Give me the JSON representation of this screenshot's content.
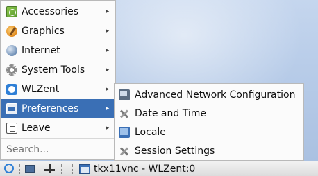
{
  "main_menu": {
    "items": [
      {
        "label": "Accessories",
        "icon": "accessories-icon",
        "has_submenu": true
      },
      {
        "label": "Graphics",
        "icon": "graphics-icon",
        "has_submenu": true
      },
      {
        "label": "Internet",
        "icon": "internet-icon",
        "has_submenu": true
      },
      {
        "label": "System Tools",
        "icon": "system-tools-icon",
        "has_submenu": true
      },
      {
        "label": "WLZent",
        "icon": "wlzent-icon",
        "has_submenu": true
      },
      {
        "label": "Preferences",
        "icon": "preferences-icon",
        "has_submenu": true,
        "active": true
      },
      {
        "label": "Leave",
        "icon": "leave-icon",
        "has_submenu": true
      }
    ],
    "search_placeholder": "Search..."
  },
  "submenu": {
    "items": [
      {
        "label": "Advanced Network Configuration",
        "icon": "network-config-icon"
      },
      {
        "label": "Date and Time",
        "icon": "date-time-icon"
      },
      {
        "label": "Locale",
        "icon": "locale-icon"
      },
      {
        "label": "Session Settings",
        "icon": "session-settings-icon"
      }
    ]
  },
  "taskbar": {
    "window_title": "tkx11vnc - WLZent:0"
  },
  "colors": {
    "highlight": "#3a6fb5",
    "desktop": "#b9cde9"
  }
}
